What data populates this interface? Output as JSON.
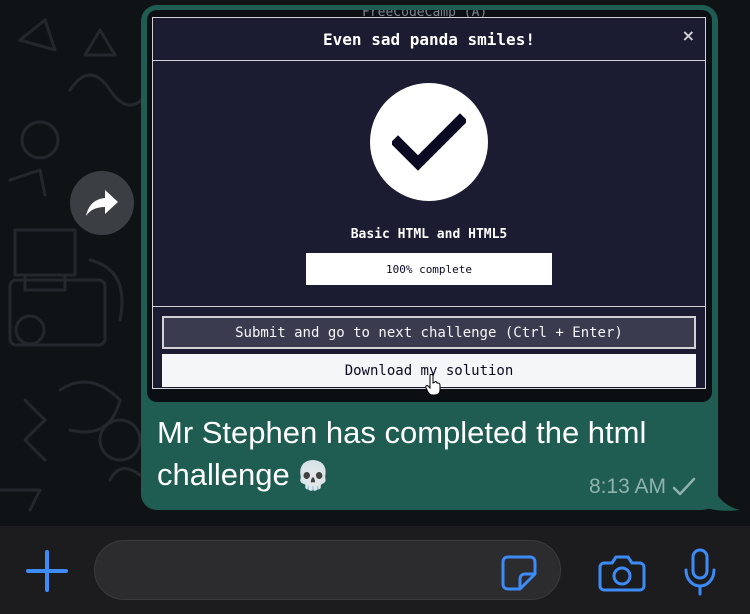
{
  "screenshot": {
    "partial_top_text": "FreeCodeCamp (A)",
    "modal": {
      "title": "Even sad panda smiles!",
      "close_label": "×",
      "certification": "Basic HTML and HTML5",
      "progress_value": 1.0,
      "progress_label": "100% complete",
      "submit_label": "Submit and go to next challenge (Ctrl + Enter)",
      "download_label": "Download my solution"
    }
  },
  "message": {
    "text": "Mr Stephen has completed the html challenge",
    "emoji": "💀",
    "time": "8:13 AM",
    "status_icon": "check-icon"
  },
  "icons": {
    "forward": "forward-arrow-icon",
    "plus": "plus-icon",
    "sticker": "sticker-icon",
    "camera": "camera-icon",
    "mic": "microphone-icon"
  },
  "colors": {
    "bubble": "#1f5c52",
    "accent": "#3d8bf7",
    "modal_bg": "#1b1b32",
    "wallpaper": "#101316"
  }
}
